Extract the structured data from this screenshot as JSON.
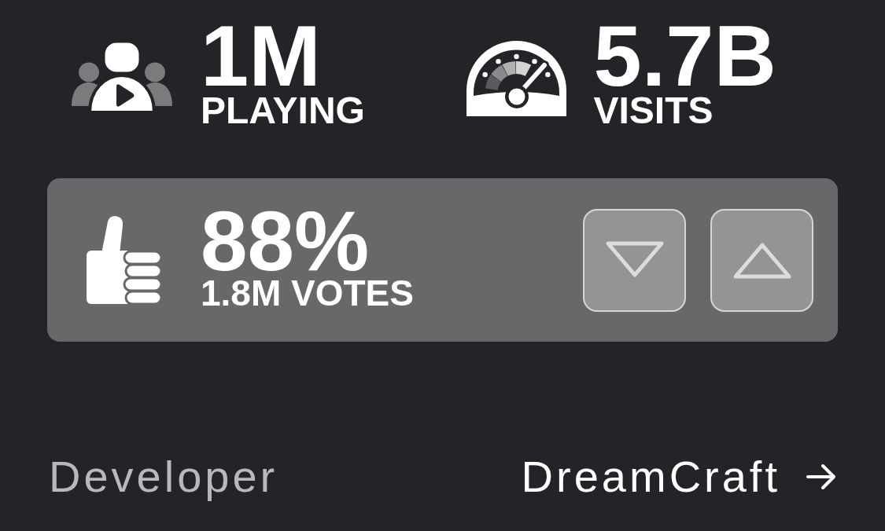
{
  "stats": [
    {
      "kind": "players",
      "value": "1M",
      "label": "PLAYING"
    },
    {
      "kind": "visits",
      "value": "5.7B",
      "label": "VISITS"
    }
  ],
  "rating": {
    "percent": "88%",
    "votes": "1.8M VOTES",
    "vote_buttons": [
      {
        "kind": "down"
      },
      {
        "kind": "up"
      }
    ]
  },
  "developer": {
    "label": "Developer",
    "name": "DreamCraft"
  }
}
